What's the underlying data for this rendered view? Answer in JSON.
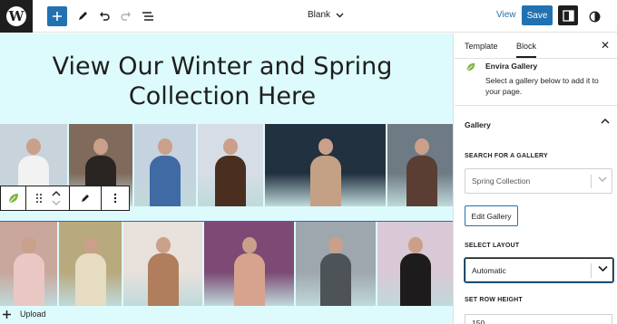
{
  "topbar": {
    "template_name": "Blank",
    "view_label": "View",
    "save_label": "Save"
  },
  "canvas": {
    "title": "View Our Winter and Spring Collection Here",
    "upload_label": "Upload",
    "row1_photos": [
      {
        "subject": "person in white winter coat in snowy forest",
        "bg": "#c9d3dc",
        "fg": "#f2f2f2"
      },
      {
        "subject": "man in dark coat on city street",
        "bg": "#7f6a5b",
        "fg": "#2a2522"
      },
      {
        "subject": "person in blue puffer jacket and winter hat",
        "bg": "#c5d2df",
        "fg": "#3f6aa4"
      },
      {
        "subject": "woman in shearling coat smiling in snow",
        "bg": "#d7dde6",
        "fg": "#4a2f20"
      },
      {
        "subject": "woman with earmuffs blowing snow",
        "bg": "#22313f",
        "fg": "#c4a184"
      },
      {
        "subject": "woman in knit hat with sunglasses in snow",
        "bg": "#6e7a84",
        "fg": "#5a3e33"
      }
    ],
    "row2_photos": [
      {
        "subject": "woman in pink outfit among flowers",
        "bg": "#c9a79c",
        "fg": "#e9c8c4"
      },
      {
        "subject": "woman in straw hat in spring garden",
        "bg": "#b9a97e",
        "fg": "#e6dcc2"
      },
      {
        "subject": "woman in white dress on balcony",
        "bg": "#e8e1dc",
        "fg": "#b07e5c"
      },
      {
        "subject": "woman with purple flowers close-up",
        "bg": "#7c4a74",
        "fg": "#d7a38f"
      },
      {
        "subject": "woman by stone bridge in city",
        "bg": "#9ea6ae",
        "fg": "#4d5357"
      },
      {
        "subject": "woman in black hat and white shirt",
        "bg": "#d9c8d5",
        "fg": "#1e1b1d"
      }
    ]
  },
  "sidebar": {
    "tab_template": "Template",
    "tab_block": "Block",
    "block_name": "Envira Gallery",
    "block_description": "Select a gallery below to add it to your page.",
    "panel_title": "Gallery",
    "search_label": "SEARCH FOR A GALLERY",
    "search_value": "Spring Collection",
    "edit_gallery_label": "Edit Gallery",
    "layout_label": "SELECT LAYOUT",
    "layout_value": "Automatic",
    "row_height_label": "SET ROW HEIGHT",
    "row_height_value": "150"
  },
  "colors": {
    "accent": "#2271b1",
    "canvas_bg": "#ddfbfc",
    "envira_green": "#7cb342",
    "dark": "#1e1e1e"
  }
}
